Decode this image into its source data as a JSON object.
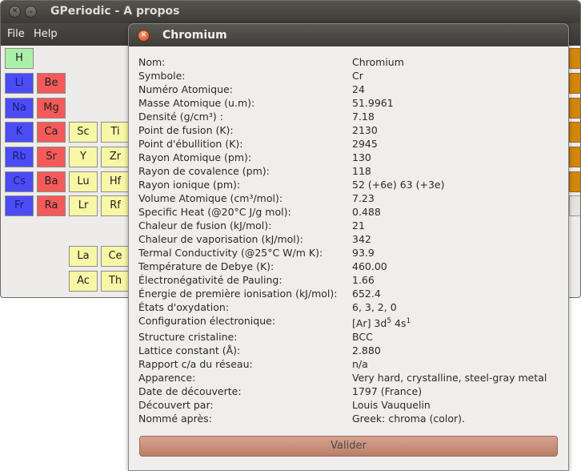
{
  "window": {
    "title": "GPeriodic - A propos"
  },
  "menubar": {
    "items": [
      "File",
      "Help"
    ]
  },
  "elements": [
    {
      "symbol": "H",
      "group": "g0"
    },
    {
      "symbol": "Li",
      "group": "g1"
    },
    {
      "symbol": "Be",
      "group": "g2"
    },
    {
      "symbol": "Na",
      "group": "g1"
    },
    {
      "symbol": "Mg",
      "group": "g2"
    },
    {
      "symbol": "K",
      "group": "g1"
    },
    {
      "symbol": "Ca",
      "group": "g2"
    },
    {
      "symbol": "Sc",
      "group": "g3"
    },
    {
      "symbol": "Ti",
      "group": "g3"
    },
    {
      "symbol": "Rb",
      "group": "g1"
    },
    {
      "symbol": "Sr",
      "group": "g2"
    },
    {
      "symbol": "Y",
      "group": "g3"
    },
    {
      "symbol": "Zr",
      "group": "g3"
    },
    {
      "symbol": "Cs",
      "group": "g1"
    },
    {
      "symbol": "Ba",
      "group": "g2"
    },
    {
      "symbol": "Lu",
      "group": "g3"
    },
    {
      "symbol": "Hf",
      "group": "g3"
    },
    {
      "symbol": "Fr",
      "group": "g1"
    },
    {
      "symbol": "Ra",
      "group": "g2"
    },
    {
      "symbol": "Lr",
      "group": "g3"
    },
    {
      "symbol": "Rf",
      "group": "g3"
    },
    {
      "symbol": "La",
      "group": "g3"
    },
    {
      "symbol": "Ce",
      "group": "g3"
    },
    {
      "symbol": "Ac",
      "group": "g3"
    },
    {
      "symbol": "Th",
      "group": "g3"
    }
  ],
  "dialog": {
    "title": "Chromium",
    "properties": [
      {
        "label": "Nom:",
        "value": "Chromium"
      },
      {
        "label": "Symbole:",
        "value": "Cr"
      },
      {
        "label": "Numéro Atomique:",
        "value": "24"
      },
      {
        "label": "Masse Atomique (u.m):",
        "value": "51.9961"
      },
      {
        "label": "Densité (g/cm³) :",
        "value": "7.18"
      },
      {
        "label": "Point de fusion (K):",
        "value": "2130"
      },
      {
        "label": "Point d'ébullition (K):",
        "value": "2945"
      },
      {
        "label": "Rayon Atomique (pm):",
        "value": "130"
      },
      {
        "label": "Rayon de covalence (pm):",
        "value": "118"
      },
      {
        "label": "Rayon ionique (pm):",
        "value": "52 (+6e) 63 (+3e)"
      },
      {
        "label": "Volume Atomique (cm³/mol):",
        "value": "7.23"
      },
      {
        "label": "Specific Heat (@20°C J/g mol):",
        "value": "0.488"
      },
      {
        "label": "Chaleur de fusion (kJ/mol):",
        "value": "21"
      },
      {
        "label": "Chaleur de vaporisation (kJ/mol):",
        "value": "342"
      },
      {
        "label": "Termal Conductivity (@25°C W/m K):",
        "value": "93.9"
      },
      {
        "label": "Température de Debye (K):",
        "value": "460.00"
      },
      {
        "label": "Électronégativité de Pauling:",
        "value": "1.66"
      },
      {
        "label": "Énergie de première ionisation (kJ/mol):",
        "value": "652.4"
      },
      {
        "label": "États d'oxydation:",
        "value": "6, 3, 2, 0"
      },
      {
        "label": "Configuration électronique:",
        "value": "",
        "config": {
          "base": "[Ar] 3d",
          "sup1": "5",
          "mid": " 4s",
          "sup2": "1"
        }
      },
      {
        "label": "Structure cristaline:",
        "value": "BCC"
      },
      {
        "label": "Lattice constant (Å):",
        "value": "2.880"
      },
      {
        "label": "Rapport c/a du réseau:",
        "value": "n/a"
      },
      {
        "label": "Apparence:",
        "value": "Very hard, crystalline, steel-gray metal"
      },
      {
        "label": "Date de découverte:",
        "value": "1797 (France)"
      },
      {
        "label": "Découvert par:",
        "value": "Louis Vauquelin"
      },
      {
        "label": "Nommé après:",
        "value": "Greek: chroma (color)."
      }
    ],
    "valider_label": "Valider"
  },
  "icons": {
    "close": "close-icon",
    "minimize": "minimize-icon"
  },
  "colors": {
    "alkali": "#4c4cf5",
    "alkaline_earth": "#f55a5a",
    "transition": "#f8f7a6",
    "nonmetal": "#aaf0aa",
    "valider": "#c48a74"
  }
}
